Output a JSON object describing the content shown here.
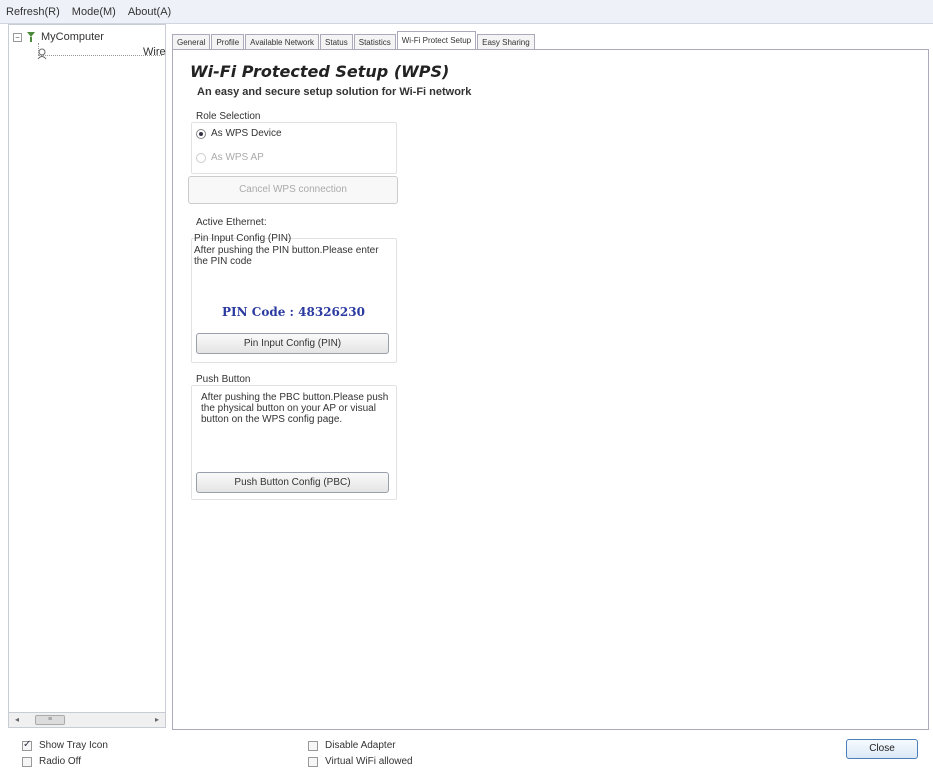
{
  "menubar": {
    "items": [
      "Refresh(R)",
      "Mode(M)",
      "About(A)"
    ]
  },
  "tree": {
    "root_label": "MyComputer",
    "root_expander": "−",
    "child_label": "Wire"
  },
  "tabs": [
    "General",
    "Profile",
    "Available Network",
    "Status",
    "Statistics",
    "Wi-Fi Protect Setup",
    "Easy Sharing"
  ],
  "active_tab_index": 5,
  "wps": {
    "title": "Wi-Fi Protected Setup (WPS)",
    "subtitle": "An easy and secure setup solution for Wi-Fi network",
    "role_selection_label": "Role Selection",
    "role_device_label": "As WPS Device",
    "role_ap_label": "As WPS AP",
    "cancel_button": "Cancel WPS connection",
    "active_ethernet_label": "Active Ethernet:",
    "pin_group_label": "Pin Input Config (PIN)",
    "pin_instructions": "After pushing the PIN button.Please enter the PIN code",
    "pin_code_text": "PIN Code :  48326230",
    "pin_button": "Pin Input Config (PIN)",
    "push_group_label": "Push Button",
    "push_instructions": "After pushing the PBC button.Please push the physical button on your AP or visual button on the WPS config page.",
    "push_button": "Push Button Config (PBC)"
  },
  "scrollbar": {
    "left_arrow": "◂",
    "right_arrow": "▸",
    "thumb_grip": "≡"
  },
  "bottom": {
    "show_tray_icon": "Show Tray Icon",
    "radio_off": "Radio Off",
    "disable_adapter": "Disable Adapter",
    "virtual_wifi": "Virtual WiFi allowed",
    "close_button": "Close"
  },
  "colors": {
    "pin_code": "#2b3aa0",
    "close_border": "#4a7fb8"
  }
}
